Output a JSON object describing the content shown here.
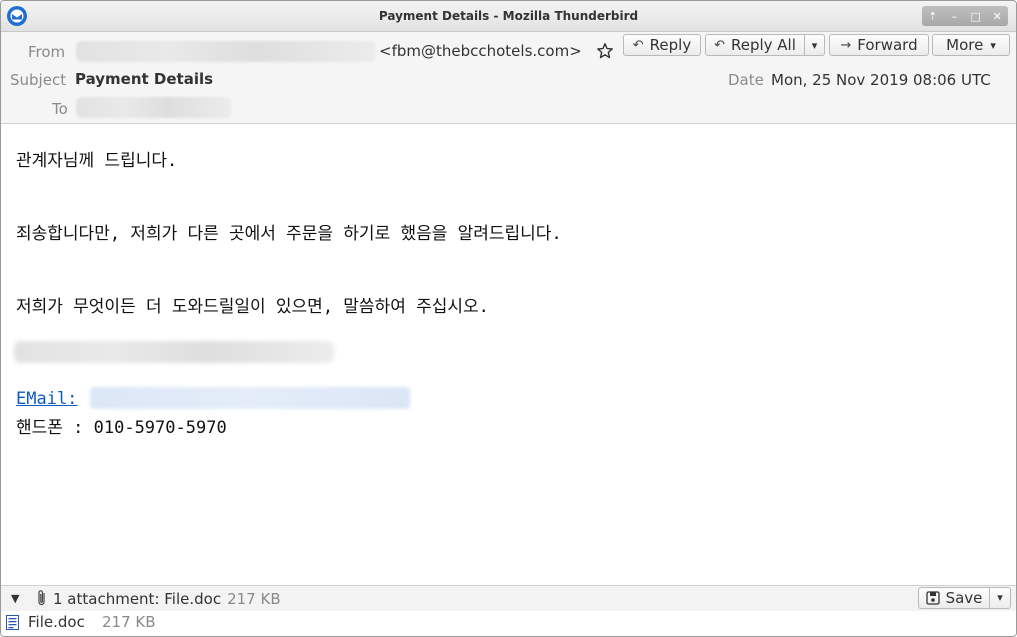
{
  "window": {
    "title": "Payment Details - Mozilla Thunderbird"
  },
  "header": {
    "from_label": "From",
    "from_address": "<fbm@thebcchotels.com>",
    "subject_label": "Subject",
    "subject": "Payment Details",
    "to_label": "To",
    "date_label": "Date",
    "date": "Mon, 25 Nov 2019 08:06 UTC"
  },
  "toolbar": {
    "reply": "Reply",
    "reply_all": "Reply All",
    "forward": "Forward",
    "more": "More"
  },
  "message": {
    "line1": "관계자님께 드립니다.",
    "line2": "죄송합니다만, 저희가 다른 곳에서 주문을 하기로 했음을 알려드립니다.",
    "line3": "저희가 무엇이든 더 도와드릴일이 있으면, 말씀하여 주십시오.",
    "email_label": "EMail:",
    "phone_line": "핸드폰 : 010-5970-5970"
  },
  "attachments": {
    "summary": "1 attachment: File.doc",
    "summary_size": "217 KB",
    "save_label": "Save",
    "files": [
      {
        "name": "File.doc",
        "size": "217 KB"
      }
    ]
  }
}
